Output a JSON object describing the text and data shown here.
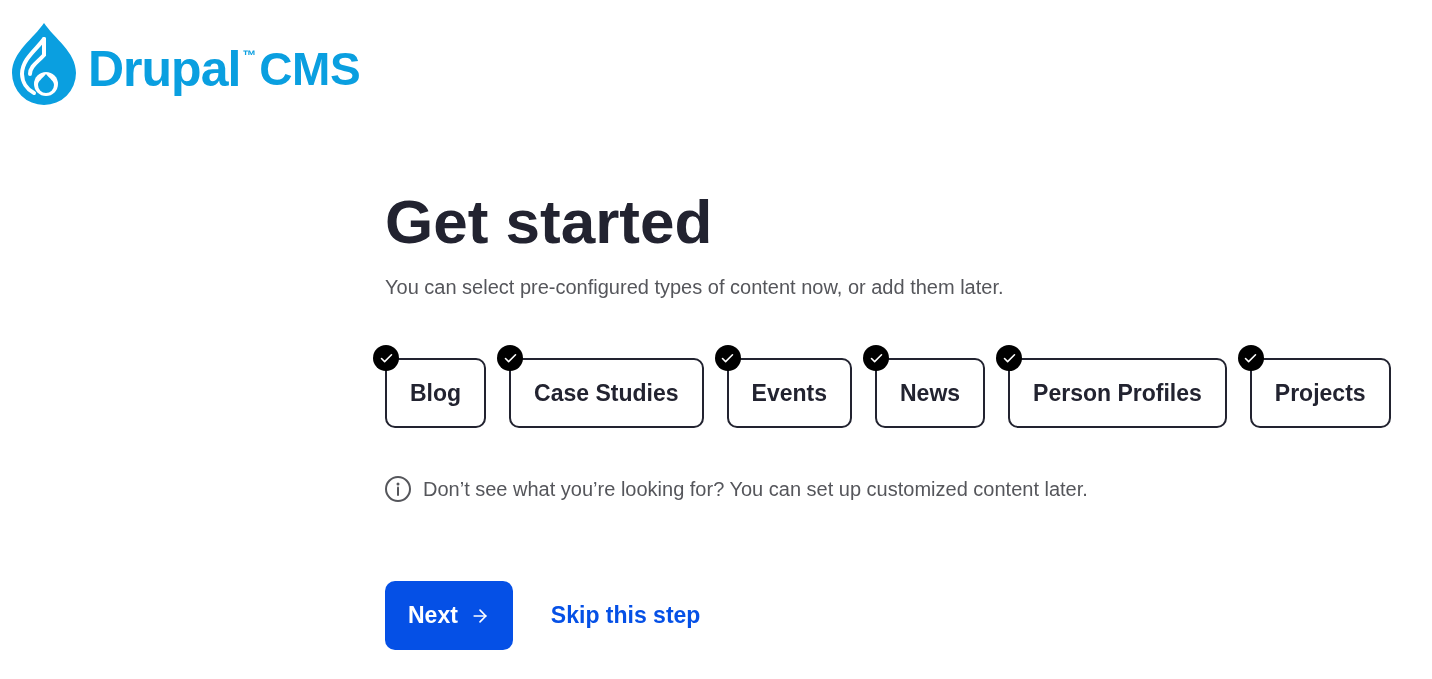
{
  "logo": {
    "name": "Drupal",
    "trademark": "™",
    "product": "CMS"
  },
  "heading": "Get started",
  "subtitle": "You can select pre-configured types of content now, or add them later.",
  "content_types": [
    {
      "label": "Blog",
      "selected": true
    },
    {
      "label": "Case Studies",
      "selected": true
    },
    {
      "label": "Events",
      "selected": true
    },
    {
      "label": "News",
      "selected": true
    },
    {
      "label": "Person Profiles",
      "selected": true
    },
    {
      "label": "Projects",
      "selected": true
    }
  ],
  "note": "Don’t see what you’re looking for? You can set up customized content later.",
  "actions": {
    "next": "Next",
    "skip": "Skip this step"
  }
}
